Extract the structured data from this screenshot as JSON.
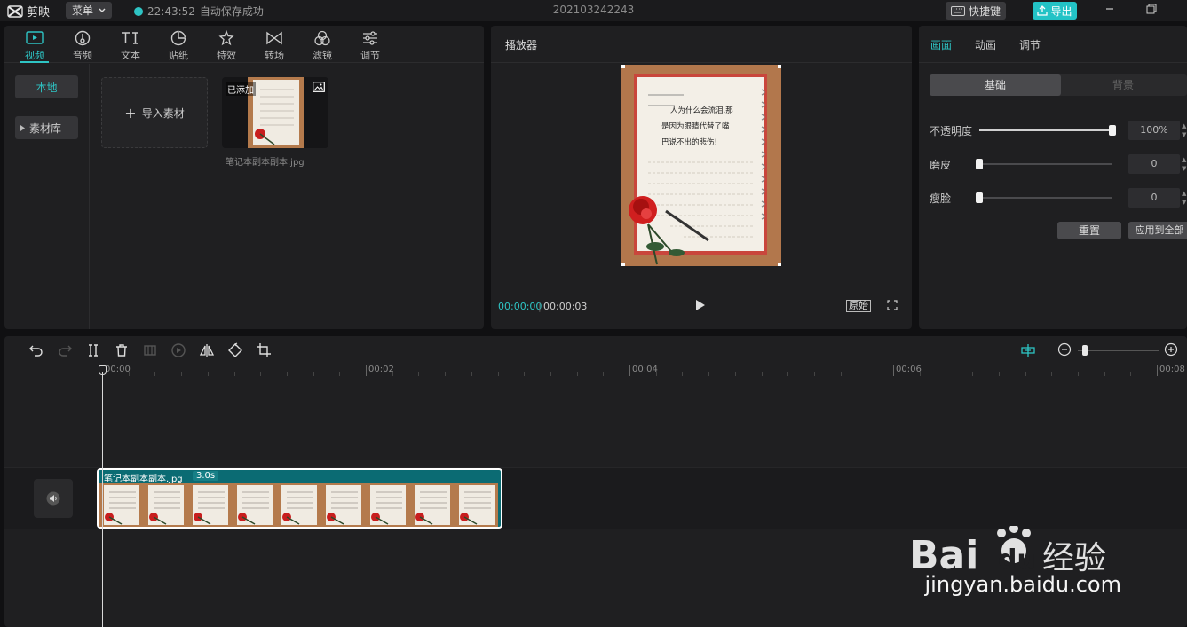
{
  "app": {
    "name": "剪映",
    "menu_label": "菜单",
    "autosave_time": "22:43:52",
    "autosave_text": "自动保存成功",
    "project_title": "202103242243",
    "shortcut_label": "快捷键",
    "export_label": "导出"
  },
  "media_tabs": [
    {
      "label": "视频",
      "icon": "video-icon"
    },
    {
      "label": "音频",
      "icon": "audio-icon"
    },
    {
      "label": "文本",
      "icon": "text-icon"
    },
    {
      "label": "贴纸",
      "icon": "sticker-icon"
    },
    {
      "label": "特效",
      "icon": "effects-icon"
    },
    {
      "label": "转场",
      "icon": "transition-icon"
    },
    {
      "label": "滤镜",
      "icon": "filter-icon"
    },
    {
      "label": "调节",
      "icon": "adjust-icon"
    }
  ],
  "media_side": {
    "local": "本地",
    "library": "素材库"
  },
  "media": {
    "import_label": "导入素材",
    "item_badge": "已添加",
    "item_name": "笔记本副本副本.jpg"
  },
  "player": {
    "title": "播放器",
    "current_time": "00:00:00",
    "total_time": "00:00:03",
    "ratio_label": "原始",
    "preview_text": [
      "人为什么会流泪,那",
      "是因为眼睛代替了嘴",
      "巴说不出的悲伤!"
    ]
  },
  "props": {
    "tabs": [
      "画面",
      "动画",
      "调节"
    ],
    "segments": {
      "basic": "基础",
      "background": "背景"
    },
    "rows": [
      {
        "label": "不透明度",
        "value": "100%",
        "level": 1.0
      },
      {
        "label": "磨皮",
        "value": "0",
        "level": 0.0
      },
      {
        "label": "瘦脸",
        "value": "0",
        "level": 0.0
      }
    ],
    "reset_label": "重置",
    "apply_all_label": "应用到全部"
  },
  "timeline": {
    "ticks": [
      "00:00",
      "00:02",
      "00:04",
      "00:06",
      "00:08"
    ],
    "clip_name": "笔记本副本副本.jpg",
    "clip_duration": "3.0s"
  },
  "watermark": {
    "url": "jingyan.baidu.com"
  },
  "colors": {
    "accent": "#2ec4c4",
    "clip": "#0b6b73"
  }
}
